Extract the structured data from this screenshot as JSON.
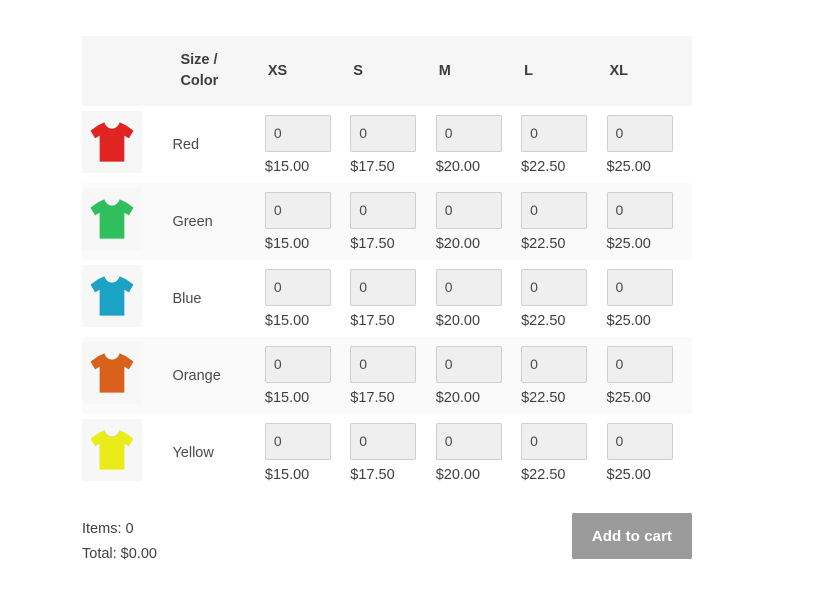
{
  "table": {
    "header": {
      "corner_label_line1": "Size /",
      "corner_label_line2": "Color",
      "sizes": [
        "XS",
        "S",
        "M",
        "L",
        "XL"
      ]
    },
    "rows": [
      {
        "color_label": "Red",
        "thumb_icon": "tshirt-icon",
        "swatch": "#e02421",
        "cells": [
          {
            "size": "XS",
            "qty": "0",
            "price": "$15.00"
          },
          {
            "size": "S",
            "qty": "0",
            "price": "$17.50"
          },
          {
            "size": "M",
            "qty": "0",
            "price": "$20.00"
          },
          {
            "size": "L",
            "qty": "0",
            "price": "$22.50"
          },
          {
            "size": "XL",
            "qty": "0",
            "price": "$25.00"
          }
        ]
      },
      {
        "color_label": "Green",
        "thumb_icon": "tshirt-icon",
        "swatch": "#2fbf5c",
        "cells": [
          {
            "size": "XS",
            "qty": "0",
            "price": "$15.00"
          },
          {
            "size": "S",
            "qty": "0",
            "price": "$17.50"
          },
          {
            "size": "M",
            "qty": "0",
            "price": "$20.00"
          },
          {
            "size": "L",
            "qty": "0",
            "price": "$22.50"
          },
          {
            "size": "XL",
            "qty": "0",
            "price": "$25.00"
          }
        ]
      },
      {
        "color_label": "Blue",
        "thumb_icon": "tshirt-icon",
        "swatch": "#1ba2c4",
        "cells": [
          {
            "size": "XS",
            "qty": "0",
            "price": "$15.00"
          },
          {
            "size": "S",
            "qty": "0",
            "price": "$17.50"
          },
          {
            "size": "M",
            "qty": "0",
            "price": "$20.00"
          },
          {
            "size": "L",
            "qty": "0",
            "price": "$22.50"
          },
          {
            "size": "XL",
            "qty": "0",
            "price": "$25.00"
          }
        ]
      },
      {
        "color_label": "Orange",
        "thumb_icon": "tshirt-icon",
        "swatch": "#d9611c",
        "cells": [
          {
            "size": "XS",
            "qty": "0",
            "price": "$15.00"
          },
          {
            "size": "S",
            "qty": "0",
            "price": "$17.50"
          },
          {
            "size": "M",
            "qty": "0",
            "price": "$20.00"
          },
          {
            "size": "L",
            "qty": "0",
            "price": "$22.50"
          },
          {
            "size": "XL",
            "qty": "0",
            "price": "$25.00"
          }
        ]
      },
      {
        "color_label": "Yellow",
        "thumb_icon": "tshirt-icon",
        "swatch": "#e9ec19",
        "cells": [
          {
            "size": "XS",
            "qty": "0",
            "price": "$15.00"
          },
          {
            "size": "S",
            "qty": "0",
            "price": "$17.50"
          },
          {
            "size": "M",
            "qty": "0",
            "price": "$20.00"
          },
          {
            "size": "L",
            "qty": "0",
            "price": "$22.50"
          },
          {
            "size": "XL",
            "qty": "0",
            "price": "$25.00"
          }
        ]
      }
    ]
  },
  "footer": {
    "items_label": "Items: 0",
    "total_label": "Total: $0.00",
    "add_to_cart_label": "Add to cart",
    "button_color": "#9b9b9b"
  }
}
